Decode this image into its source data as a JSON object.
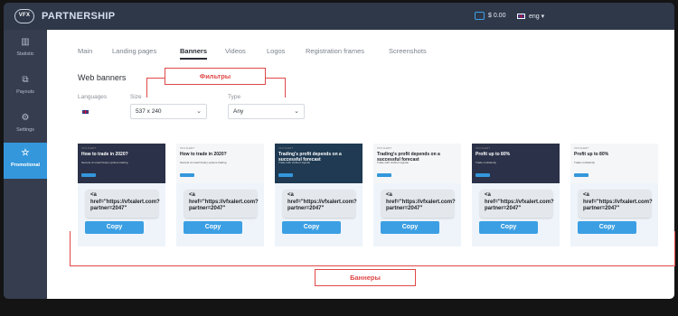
{
  "header": {
    "logo_text": "VFX",
    "brand": "PARTNERSHIP",
    "balance": "$ 0.00",
    "language": "eng ▾"
  },
  "sidebar": {
    "items": [
      {
        "label": "Statistic",
        "icon": "bar-chart-icon",
        "glyph": "▥"
      },
      {
        "label": "Payouts",
        "icon": "payouts-icon",
        "glyph": "⧉"
      },
      {
        "label": "Settings",
        "icon": "gear-icon",
        "glyph": "⚙"
      },
      {
        "label": "Promotional",
        "icon": "star-icon",
        "glyph": "☆"
      }
    ],
    "active": "Promotional"
  },
  "tabs": [
    "Main",
    "Landing pages",
    "Banners",
    "Videos",
    "Logos",
    "Registration frames",
    "Screenshots"
  ],
  "active_tab": "Banners",
  "section_title": "Web banners",
  "annotations": {
    "filters": "Фильтры",
    "banners": "Баннеры"
  },
  "filters": {
    "languages_label": "Languages",
    "size_label": "Size",
    "size_value": "537 x 240",
    "type_label": "Type",
    "type_value": "Any"
  },
  "banners": [
    {
      "head": "VFX ALERT",
      "title": "How to trade in 2020?",
      "sub": "Secrets of smart binary options trading",
      "bg": "#2b3148",
      "fg": "#ffffff",
      "code": "<a href=\"https://vfxalert.com?partner=2047\"",
      "copy": "Copy"
    },
    {
      "head": "VFX ALERT",
      "title": "How to trade in 2020?",
      "sub": "Secrets of smart binary options trading",
      "bg": "#f5f6f8",
      "fg": "#1b1e23",
      "code": "<a href=\"https://vfxalert.com?partner=2047\"",
      "copy": "Copy"
    },
    {
      "head": "VFX ALERT",
      "title": "Trading's profit depends on a successful forecast",
      "sub": "Trade with vfxAlert signals",
      "bg": "#1f3a52",
      "fg": "#ffffff",
      "code": "<a href=\"https://vfxalert.com?partner=2047\"",
      "copy": "Copy"
    },
    {
      "head": "VFX ALERT",
      "title": "Trading's profit depends on a successful forecast",
      "sub": "Trade with vfxAlert signals",
      "bg": "#f5f6f8",
      "fg": "#1b1e23",
      "code": "<a href=\"https://vfxalert.com?partner=2047\"",
      "copy": "Copy"
    },
    {
      "head": "VFX ALERT",
      "title": "Profit up to 80%",
      "sub": "Trade confidently",
      "bg": "#2b3148",
      "fg": "#ffffff",
      "code": "<a href=\"https://vfxalert.com?partner=2047\"",
      "copy": "Copy"
    },
    {
      "head": "VFX ALERT",
      "title": "Profit up to 80%",
      "sub": "Trade confidently",
      "bg": "#f5f6f8",
      "fg": "#1b1e23",
      "code": "<a href=\"https://vfxalert.com?partner=2047\"",
      "copy": "Copy"
    }
  ],
  "colors": {
    "accent": "#3497dc",
    "annotation": "#e04848",
    "sidebar": "#353d4e",
    "topbar": "#2f3849"
  }
}
